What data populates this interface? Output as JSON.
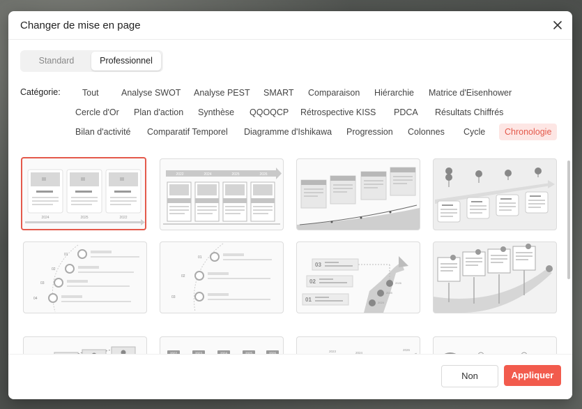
{
  "dialog": {
    "title": "Changer de mise en page"
  },
  "tabs": {
    "standard": "Standard",
    "professional": "Professionnel"
  },
  "categories": {
    "label": "Catégorie:",
    "items": [
      "Tout",
      "Analyse SWOT",
      "Analyse PEST",
      "SMART",
      "Comparaison",
      "Hiérarchie",
      "Matrice d'Eisenhower",
      "Cercle d'Or",
      "Plan d'action",
      "Synthèse",
      "QQOQCP",
      "Rétrospective KISS",
      "PDCA",
      "Résultats Chiffrés",
      "Bilan d'activité",
      "Comparatif Temporel",
      "Diagramme d'Ishikawa",
      "Progression",
      "Colonnes",
      "Cycle",
      "Chronologie"
    ],
    "active": "Chronologie"
  },
  "thumbs": {
    "t1_years": [
      "2024",
      "2025",
      "2022"
    ],
    "t2_years": [
      "2022",
      "2024",
      "2025",
      "2026"
    ],
    "t5_nums": [
      "01",
      "02",
      "03",
      "04"
    ],
    "t6_nums": [
      "01",
      "02",
      "03"
    ],
    "t7_nums": [
      "03",
      "02",
      "01"
    ],
    "t7_years": [
      "2026",
      "2025",
      "2024"
    ],
    "t10_years": [
      "2022",
      "2023",
      "2024",
      "2025",
      "2026"
    ],
    "t11_years": [
      "2021",
      "2023",
      "2024",
      "2025",
      "2026"
    ],
    "t12_labels": [
      "01",
      "02"
    ]
  },
  "footer": {
    "cancel": "Non",
    "apply": "Appliquer"
  },
  "colors": {
    "accent": "#f25b4d",
    "chip_active_bg": "#fde6e4"
  }
}
